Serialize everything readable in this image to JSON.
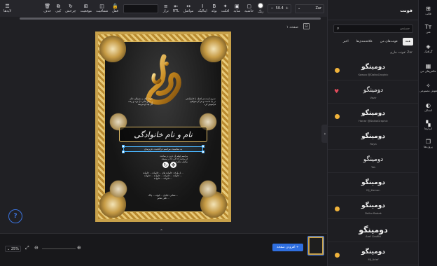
{
  "toolbar": {
    "layers_label": "لایه‌ها",
    "items": [
      {
        "label": "حذف",
        "icon": "trash-icon",
        "glyph": "🗑"
      },
      {
        "label": "کپی",
        "icon": "copy-icon",
        "glyph": "⧉"
      },
      {
        "label": "چرخش",
        "icon": "rotate-icon",
        "glyph": "↻"
      },
      {
        "label": "موقعیت",
        "icon": "position-icon",
        "glyph": "⊞"
      },
      {
        "label": "شفافیت",
        "icon": "opacity-icon",
        "glyph": "◫"
      },
      {
        "label": "قفل",
        "icon": "lock-icon",
        "glyph": "🔒"
      }
    ],
    "format_items": [
      {
        "label": "تراز",
        "icon": "align-icon",
        "glyph": "≡"
      },
      {
        "label": "RTL",
        "icon": "rtl-icon",
        "glyph": "⇤"
      },
      {
        "label": "مواصل",
        "icon": "spacing-icon",
        "glyph": "↔"
      },
      {
        "label": "ایتالیک",
        "icon": "italic-icon",
        "glyph": "I"
      },
      {
        "label": "بولد",
        "icon": "bold-icon",
        "glyph": "B"
      },
      {
        "label": "افکت",
        "icon": "effect-icon",
        "glyph": "✦"
      },
      {
        "label": "سایه",
        "icon": "shadow-icon",
        "glyph": "▣"
      },
      {
        "label": "حاشیه",
        "icon": "border-icon",
        "glyph": "▢"
      },
      {
        "label": "رنگ",
        "icon": "color-icon",
        "glyph": ""
      }
    ],
    "font_size": "50.4",
    "font_name": "Zar",
    "text_color": "#ffffff"
  },
  "canvas": {
    "page_label": "صفحه ۱",
    "help": "?",
    "poster": {
      "title_text": "نام و نام خانوادگی",
      "intro_lines": [
        "خوشا آنکه به شیطانِ عالم",
        "ز دنیایِ فانی دل بُرید و رفت",
        "گل بیاد او میرسد"
      ],
      "right_lines": [
        "عمری است هر لحظه با خاطراتش",
        "در یادِ ماست و هر گز نخواهیم",
        "فراموش کرد"
      ],
      "selected_line": "به مناسبت مراسم درگذشت عزیزمان",
      "body_lines": [
        "مراسم چهلم آن عزیز در ساعت",
        "از ساعت ۱۶ الی ۱۸ در مسجد",
        "برگزار میگردد"
      ],
      "footer_lines": [
        "از طرف: خانواده های ... خانواده ... خانواده ...",
        "خانواده ... خانواده ... خانواده ... خانواده ...",
        "خانواده ... خانواده ..."
      ],
      "address_lines": [
        "نشانی: خیابان ... کوچه ... پلاک ...",
        "تلفن تماس ..."
      ]
    }
  },
  "bottombar": {
    "zoom": "25%",
    "add_page_label": "افزودن صفحه"
  },
  "font_panel": {
    "title": "فونت",
    "search_placeholder": "جستجو",
    "tabs": [
      "همه",
      "فونت‌های من",
      "علاقه‌مندی‌ها",
      "اخیر"
    ],
    "active_tab": "همه",
    "current_font_label": "فونت جاری: Zar",
    "fonts": [
      {
        "sample": "دومینگو",
        "name": "Kowoo @DalkoGraphic",
        "fav": "star",
        "size": 9,
        "weight": "bold"
      },
      {
        "sample": "دومینگو",
        "name": "Vazir",
        "fav": "heart",
        "size": 9,
        "weight": "normal"
      },
      {
        "sample": "دومینگو",
        "name": "Honar @DalkoGraphic",
        "fav": "star",
        "size": 9,
        "weight": "bold"
      },
      {
        "sample": "دومینگو",
        "name": "Roya",
        "fav": "",
        "size": 9,
        "weight": "bold"
      },
      {
        "sample": "دومینگو",
        "name": "Yas",
        "fav": "",
        "size": 9,
        "weight": "normal"
      },
      {
        "sample": "دومینگو",
        "name": "Mj_Kaman",
        "fav": "",
        "size": 9,
        "weight": "bold"
      },
      {
        "sample": "دومینگو",
        "name": "Dalko Babak",
        "fav": "star",
        "size": 9,
        "weight": "bold"
      },
      {
        "sample": "دومینگو",
        "name": "Aref Graffiti",
        "fav": "",
        "size": 11,
        "weight": "bold"
      },
      {
        "sample": "دومینگو",
        "name": "Mj_Arief",
        "fav": "star",
        "size": 9,
        "weight": "bold"
      }
    ]
  },
  "nav": [
    {
      "label": "قالب",
      "icon": "template-icon",
      "glyph": "⊞"
    },
    {
      "label": "متن",
      "icon": "text-icon",
      "glyph": "Tт"
    },
    {
      "label": "گرافیک",
      "icon": "graphic-icon",
      "glyph": "◈"
    },
    {
      "label": "عکس‌های من",
      "icon": "photos-icon",
      "glyph": "▦"
    },
    {
      "label": "هوش مصنوعی",
      "icon": "ai-icon",
      "glyph": "✧"
    },
    {
      "label": "استایل",
      "icon": "style-icon",
      "glyph": "◐"
    },
    {
      "label": "ابزارها",
      "icon": "tools-icon",
      "glyph": "▚"
    },
    {
      "label": "پروژه‌ها",
      "icon": "projects-icon",
      "glyph": "❐"
    }
  ]
}
